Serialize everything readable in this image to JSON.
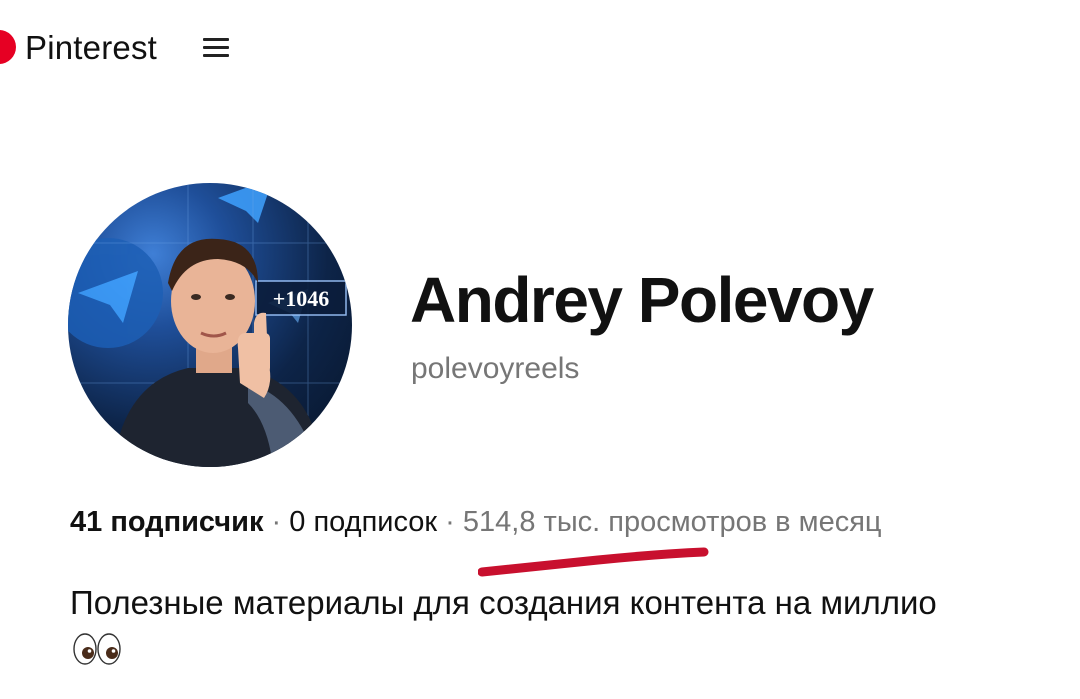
{
  "header": {
    "brand": "Pinterest",
    "brand_color": "#e60023",
    "menu_icon": "hamburger-menu-icon"
  },
  "profile": {
    "avatar_badge_text": "+1046",
    "name": "Andrey Polevoy",
    "username": "polevoyreels",
    "followers": "41 подписчик",
    "separator": " · ",
    "following": "0 подписок",
    "monthly_views": "514,8 тыс. просмотров в месяц",
    "bio": "Полезные материалы для создания контента на миллио",
    "bio_emoji": "eyes-emoji",
    "highlight_color": "#c8102e"
  }
}
